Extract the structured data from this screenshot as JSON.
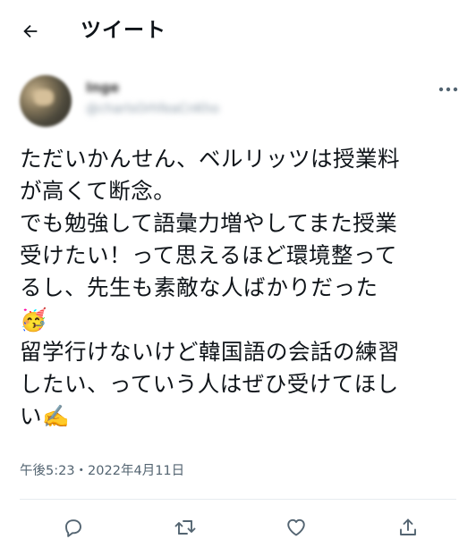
{
  "header": {
    "title": "ツイート",
    "back_icon": "arrow-left-icon"
  },
  "author": {
    "name": "Inge",
    "handle": "@charlsOrhfeaCnKho"
  },
  "tweet": {
    "lines": [
      "ただいかんせん、ベルリッツは授業料",
      "が高くて断念。",
      "でも勉強して語彙力増やしてまた授業",
      "受けたい！って思えるほど環境整って",
      "るし、先生も素敵な人ばかりだった",
      "🥳",
      "留学行けないけど韓国語の会話の練習",
      "したい、っていう人はぜひ受けてほし",
      "い✍️"
    ],
    "timestamp": "午後5:23・2022年4月11日"
  },
  "actions": [
    {
      "name": "reply",
      "icon": "reply-icon"
    },
    {
      "name": "retweet",
      "icon": "retweet-icon"
    },
    {
      "name": "like",
      "icon": "heart-icon"
    },
    {
      "name": "share",
      "icon": "share-icon"
    }
  ],
  "colors": {
    "text": "#0f1419",
    "muted": "#536471",
    "divider": "#e6ebef"
  }
}
